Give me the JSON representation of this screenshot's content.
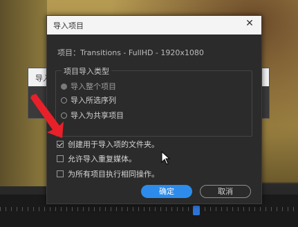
{
  "background_dialog": {
    "title": "导入"
  },
  "dialog": {
    "title": "导入项目",
    "project_line": "项目：Transitions - FullHD - 1920x1080",
    "group": {
      "legend": "项目导入类型",
      "options": [
        {
          "label": "导入整个项目",
          "selected": true
        },
        {
          "label": "导入所选序列",
          "selected": false
        },
        {
          "label": "导入为共享项目",
          "selected": false
        }
      ]
    },
    "checkboxes": [
      {
        "label": "创建用于导入项的文件夹。",
        "checked": true
      },
      {
        "label": "允许导入重复媒体。",
        "checked": false
      },
      {
        "label": "为所有项目执行相同操作。",
        "checked": false
      }
    ],
    "ok_label": "确定",
    "cancel_label": "取消"
  },
  "colors": {
    "accent": "#2d8ceb",
    "arrow": "#e8202a",
    "dialog_bg": "#2b2b2b"
  },
  "icons": [
    "close-icon",
    "annotation-arrow-icon",
    "mouse-cursor-icon"
  ]
}
